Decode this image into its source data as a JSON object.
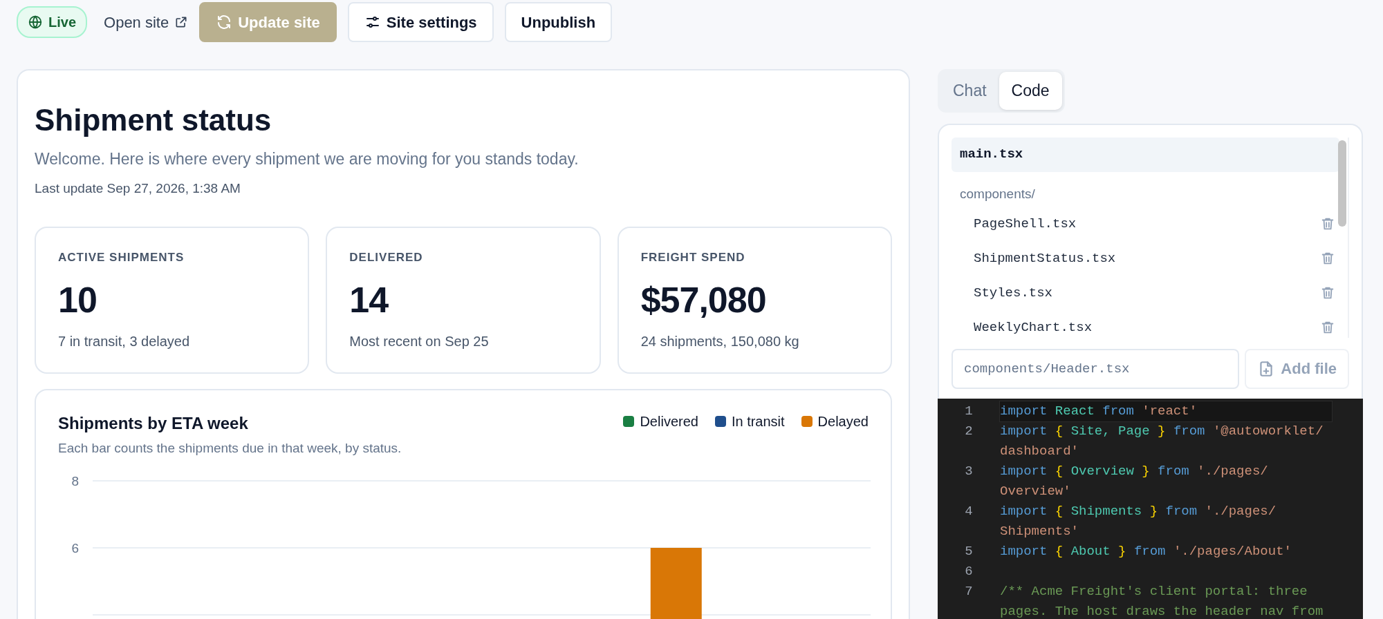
{
  "toolbar": {
    "status": {
      "label": "Live"
    },
    "open_site": {
      "label": "Open site"
    },
    "buttons": [
      {
        "label": "Update site",
        "kind": "primary"
      },
      {
        "label": "Site settings",
        "kind": "settings"
      },
      {
        "label": "Unpublish",
        "kind": "plain"
      }
    ]
  },
  "dashboard": {
    "title": "Shipment status",
    "subtitle": "Welcome. Here is where every shipment we are moving for you stands today.",
    "updated": "Last update Sep 27, 2026, 1:38 AM",
    "stats": [
      {
        "label": "ACTIVE SHIPMENTS",
        "value": "10",
        "note": "7 in transit, 3 delayed"
      },
      {
        "label": "DELIVERED",
        "value": "14",
        "note": "Most recent on Sep 25"
      },
      {
        "label": "FREIGHT SPEND",
        "value": "$57,080",
        "note": "24 shipments, 150,080 kg"
      }
    ],
    "chart": {
      "title": "Shipments by ETA week",
      "caption": "Each bar counts the shipments due in that week, by status.",
      "chart_data": {
        "type": "bar",
        "ylim": [
          4,
          8
        ],
        "yticks": [
          6,
          8
        ],
        "series": [
          {
            "name": "Delivered",
            "color": "#1a7f43",
            "values": [
              null,
              null,
              null,
              null,
              null,
              null
            ]
          },
          {
            "name": "In transit",
            "color": "#1f4e8c",
            "values": [
              null,
              null,
              null,
              null,
              null,
              null
            ]
          },
          {
            "name": "Delayed",
            "color": "#d97706",
            "values": [
              null,
              null,
              null,
              null,
              6,
              null
            ]
          }
        ]
      }
    }
  },
  "panel": {
    "tabs": [
      {
        "label": "Chat",
        "selected": false
      },
      {
        "label": "Code",
        "selected": true
      }
    ],
    "files": [
      {
        "name": "main.tsx",
        "kind": "file",
        "selected": true
      },
      {
        "name": "components/",
        "kind": "folder",
        "children": [
          {
            "name": "PageShell.tsx",
            "kind": "file",
            "selected": false
          },
          {
            "name": "ShipmentStatus.tsx",
            "kind": "file",
            "selected": false
          },
          {
            "name": "Styles.tsx",
            "kind": "file",
            "selected": false
          },
          {
            "name": "WeeklyChart.tsx",
            "kind": "file",
            "selected": false
          }
        ]
      }
    ],
    "new_file": {
      "placeholder": "components/Header.tsx"
    },
    "add_button": {
      "label": "Add file"
    },
    "code": [
      {
        "number": "1",
        "current": true,
        "tokens": [
          {
            "text": "import",
            "kind": "keyword"
          },
          {
            "text": "React",
            "kind": "name"
          },
          {
            "text": "from",
            "kind": "keyword"
          },
          {
            "text": "'react'",
            "kind": "string"
          }
        ]
      },
      {
        "number": "2",
        "current": false,
        "tokens": [
          {
            "text": "import",
            "kind": "keyword"
          },
          {
            "text": "{",
            "kind": "brace"
          },
          {
            "text": "Site,",
            "kind": "name"
          },
          {
            "text": "Page",
            "kind": "name"
          },
          {
            "text": "}",
            "kind": "brace"
          },
          {
            "text": "from",
            "kind": "keyword"
          },
          {
            "text": "'@autoworklet/dashboard'",
            "kind": "string"
          }
        ]
      },
      {
        "number": "3",
        "current": false,
        "tokens": [
          {
            "text": "import",
            "kind": "keyword"
          },
          {
            "text": "{",
            "kind": "brace"
          },
          {
            "text": "Overview",
            "kind": "name"
          },
          {
            "text": "}",
            "kind": "brace"
          },
          {
            "text": "from",
            "kind": "keyword"
          },
          {
            "text": "'./pages/Overview'",
            "kind": "string"
          }
        ]
      },
      {
        "number": "4",
        "current": false,
        "tokens": [
          {
            "text": "import",
            "kind": "keyword"
          },
          {
            "text": "{",
            "kind": "brace"
          },
          {
            "text": "Shipments",
            "kind": "name"
          },
          {
            "text": "}",
            "kind": "brace"
          },
          {
            "text": "from",
            "kind": "keyword"
          },
          {
            "text": "'./pages/Shipments'",
            "kind": "string"
          }
        ]
      },
      {
        "number": "5",
        "current": false,
        "tokens": [
          {
            "text": "import",
            "kind": "keyword"
          },
          {
            "text": "{",
            "kind": "brace"
          },
          {
            "text": "About",
            "kind": "name"
          },
          {
            "text": "}",
            "kind": "brace"
          },
          {
            "text": "from",
            "kind": "keyword"
          },
          {
            "text": "'./pages/About'",
            "kind": "string"
          }
        ]
      },
      {
        "number": "6",
        "current": false
      },
      {
        "number": "7",
        "current": false,
        "tokens": [
          {
            "text": "/** Acme Freight's client portal: three pages. The host draws the header nav from",
            "kind": "comment"
          }
        ]
      }
    ]
  }
}
